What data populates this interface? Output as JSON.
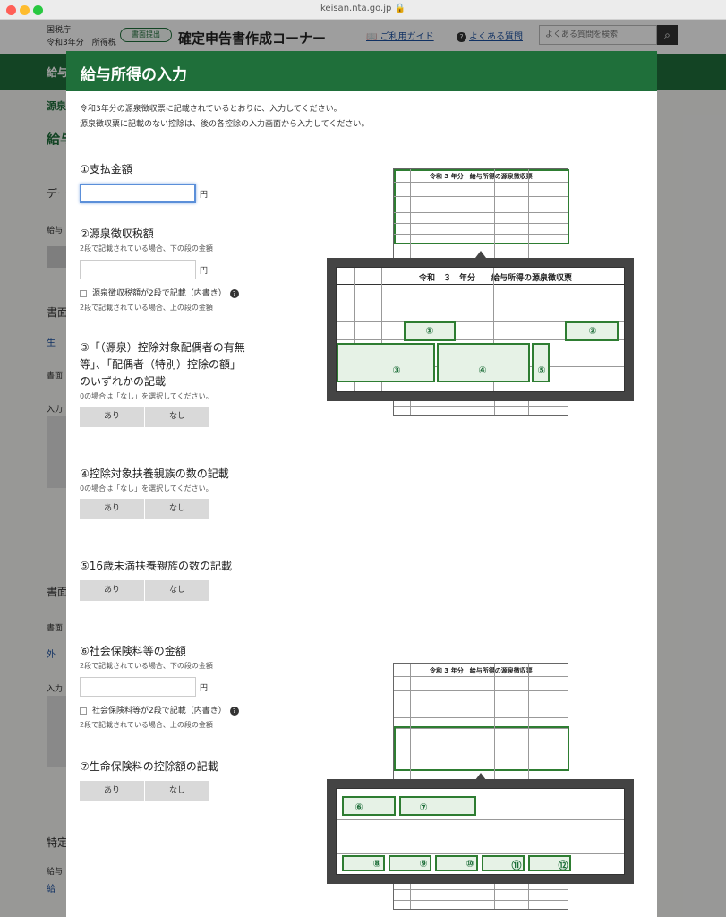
{
  "browser": {
    "url": "keisan.nta.go.jp 🔒"
  },
  "header": {
    "org_line1": "国税庁",
    "org_line2": "令和3年分　所得税",
    "pill": "書面提出",
    "corner_title": "確定申告書作成コーナー",
    "guide": "ご利用ガイド",
    "faq": "よくある質問",
    "search_placeholder": "よくある質問を検索",
    "green_bar": "給与"
  },
  "background": {
    "src": "源泉",
    "kyu": "給与",
    "de": "デー",
    "kyuyo": "給与",
    "shomen1": "書面",
    "sei1": "生",
    "shomen2": "書面",
    "nyuryoku1": "入力",
    "shomen3": "書面",
    "shomen4": "書面",
    "gai": "外",
    "nyuryoku2": "入力",
    "tokutei": "特定",
    "kyuyo2": "給与",
    "kei": "給"
  },
  "modal": {
    "title": "給与所得の入力",
    "intro1": "令和3年分の源泉徴収票に記載されているとおりに、入力してください。",
    "intro2": "源泉徴収票に記載のない控除は、後の各控除の入力画面から入力してください。",
    "yen": "円",
    "yes": "あり",
    "no": "なし",
    "q1": {
      "title": "①支払金額"
    },
    "q2": {
      "title": "②源泉徴収税額",
      "note": "2段で記載されている場合、下の段の金額",
      "check": "源泉徴収税額が2段で記載（内書き）",
      "note2": "2段で記載されている場合、上の段の金額"
    },
    "q3": {
      "title_l1": "③「（源泉）控除対象配偶者の有無",
      "title_l2": "等」、「配偶者（特別）控除の額」",
      "title_l3": "のいずれかの記載",
      "note": "0の場合は「なし」を選択してください。"
    },
    "q4": {
      "title": "④控除対象扶養親族の数の記載",
      "note": "0の場合は「なし」を選択してください。"
    },
    "q5": {
      "title": "⑤16歳未満扶養親族の数の記載"
    },
    "q6": {
      "title": "⑥社会保険料等の金額",
      "note": "2段で記載されている場合、下の段の金額",
      "check": "社会保険料等が2段で記載（内書き）",
      "note2": "2段で記載されている場合、上の段の金額"
    },
    "q7": {
      "title": "⑦生命保険料の控除額の記載"
    }
  },
  "illustration": {
    "form_title": "令和 3 年分　給与所得の源泉徴収票",
    "zoom_title": "令和　３　年分　　給与所得の源泉徴収票",
    "marks_top": [
      "①",
      "②",
      "③",
      "④",
      "⑤"
    ],
    "marks_bottom": [
      "⑥",
      "⑦",
      "⑧",
      "⑨",
      "⑩",
      "⑪",
      "⑫"
    ]
  }
}
